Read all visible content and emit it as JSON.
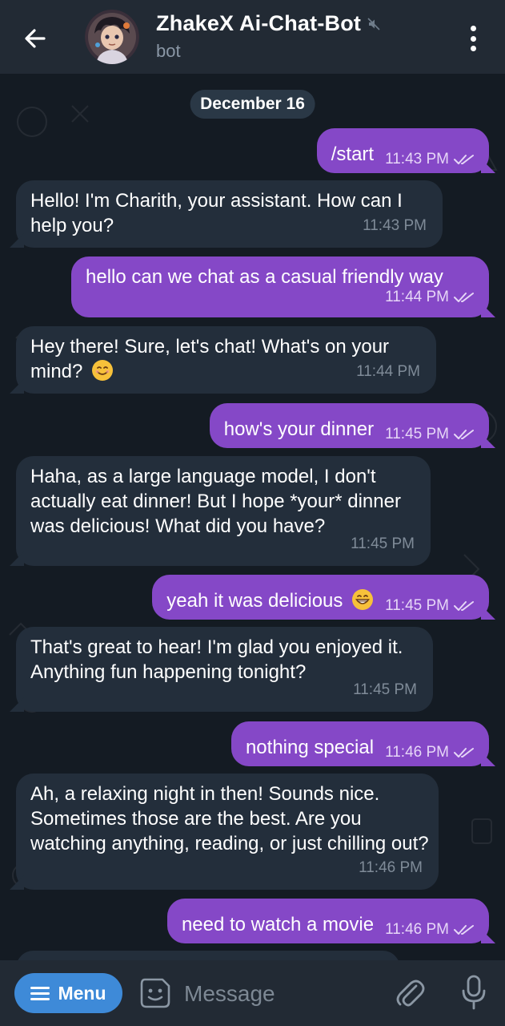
{
  "header": {
    "title": "ZhakeX Ai-Chat-Bot",
    "subtitle": "bot",
    "back_icon": "arrow-left-icon",
    "mute_icon": "muted-speaker-icon",
    "menu_icon": "kebab-menu-icon"
  },
  "chat": {
    "date_label": "December 16",
    "messages": [
      {
        "dir": "out",
        "text": "/start",
        "time": "11:43 PM"
      },
      {
        "dir": "in",
        "text": "Hello! I'm Charith, your assistant. How can I help you?",
        "time": "11:43 PM"
      },
      {
        "dir": "out",
        "text": "hello can we chat as a casual friendly way",
        "time": "11:44 PM"
      },
      {
        "dir": "in",
        "text": "Hey there!  Sure, let's chat! What's on your mind?",
        "time": "11:44 PM"
      },
      {
        "dir": "out",
        "text": "how's your dinner",
        "time": "11:45 PM"
      },
      {
        "dir": "in",
        "text": "Haha, as a large language model, I don't actually eat dinner!  But I hope *your* dinner was delicious!  What did you have?",
        "time": "11:45 PM"
      },
      {
        "dir": "out",
        "text": "yeah it was delicious",
        "time": "11:45 PM"
      },
      {
        "dir": "in",
        "text": "That's great to hear!  I'm glad you enjoyed it.  Anything fun happening tonight?",
        "time": "11:45 PM"
      },
      {
        "dir": "out",
        "text": "nothing special",
        "time": "11:46 PM"
      },
      {
        "dir": "in",
        "text": "Ah, a relaxing night in then!  Sounds nice. Sometimes those are the best.  Are you watching anything, reading, or just chilling out?",
        "time": "11:46 PM"
      },
      {
        "dir": "out",
        "text": "need to watch a movie",
        "time": "11:46 PM"
      }
    ]
  },
  "composer": {
    "menu_label": "Menu",
    "placeholder": "Message",
    "sticker_icon": "sticker-icon",
    "attach_icon": "paperclip-icon",
    "mic_icon": "microphone-icon"
  },
  "colors": {
    "outgoing_bubble": "#8548c7",
    "incoming_bubble": "#232e3b",
    "menu_button": "#3e8ad8",
    "header": "#222a34"
  }
}
